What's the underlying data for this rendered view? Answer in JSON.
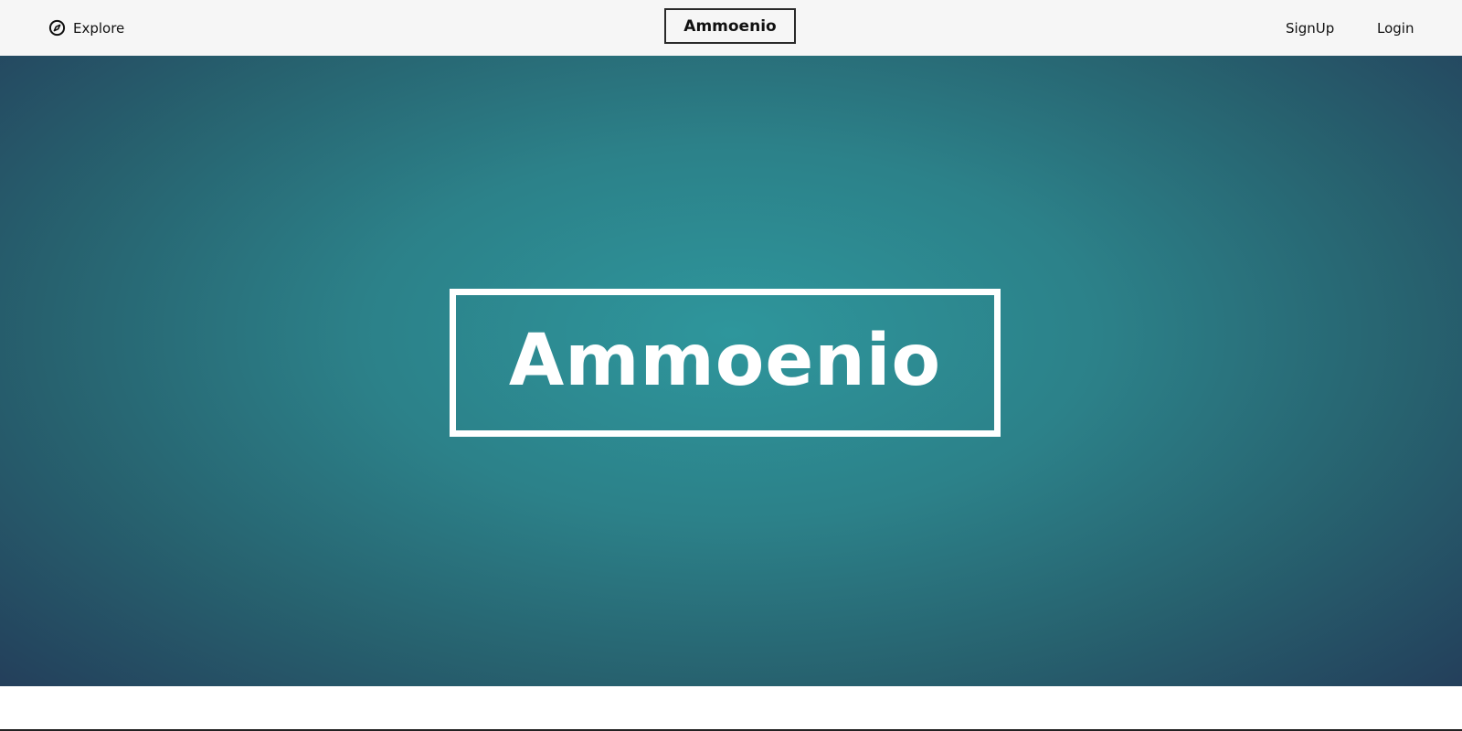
{
  "nav": {
    "explore_label": "Explore",
    "explore_icon": "compass-icon",
    "brand": "Ammoenio",
    "signup_label": "SignUp",
    "login_label": "Login"
  },
  "hero": {
    "title": "Ammoenio"
  },
  "colors": {
    "nav_background": "#f6f6f6",
    "hero_center": "#2e969c",
    "hero_edge": "#233a58",
    "hero_text": "#ffffff"
  }
}
